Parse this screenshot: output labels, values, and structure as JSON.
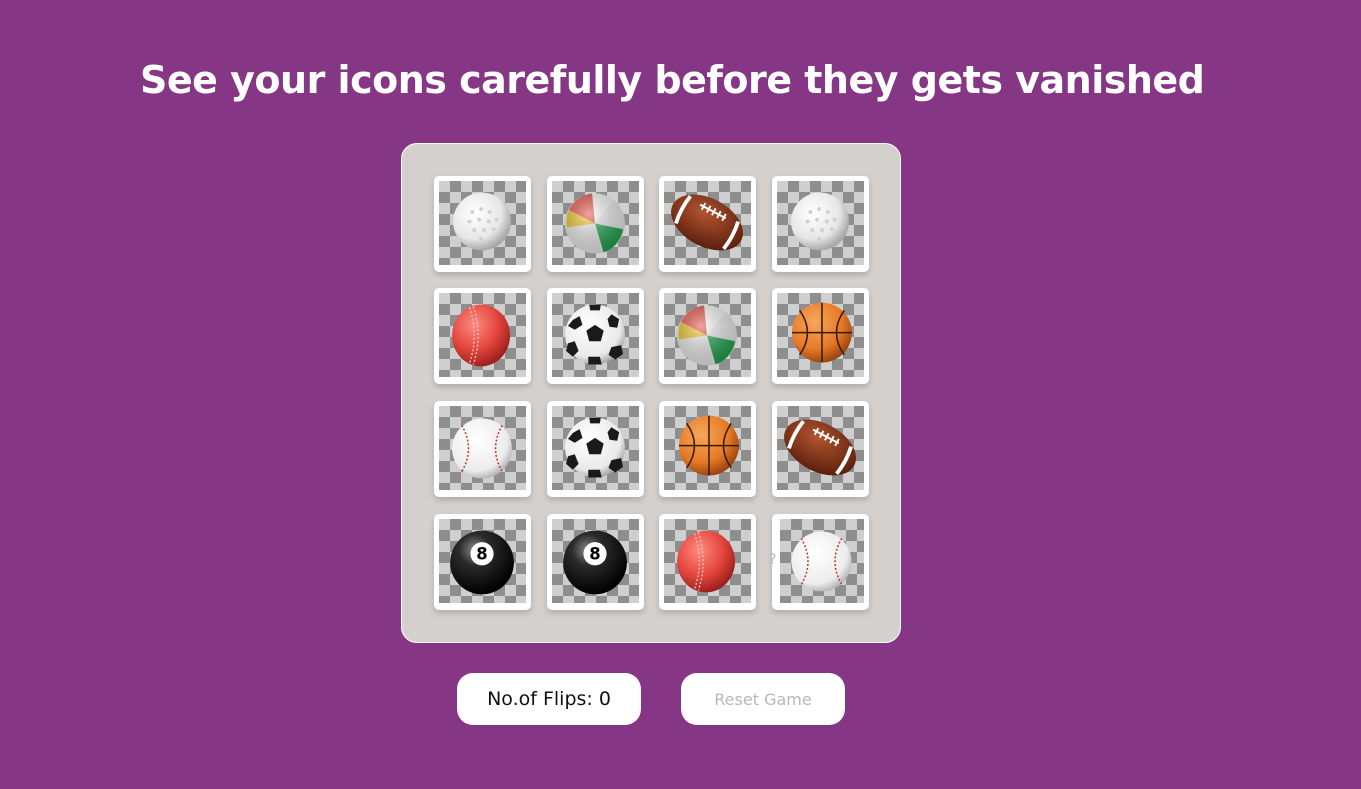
{
  "title": "See your icons carefully before they gets vanished",
  "board": {
    "columns": 4,
    "cards": [
      {
        "ball": "golf-ball"
      },
      {
        "ball": "beach-ball"
      },
      {
        "ball": "american-football"
      },
      {
        "ball": "golf-ball"
      },
      {
        "ball": "cricket-ball"
      },
      {
        "ball": "soccer-ball"
      },
      {
        "ball": "beach-ball"
      },
      {
        "ball": "basketball"
      },
      {
        "ball": "baseball"
      },
      {
        "ball": "soccer-ball"
      },
      {
        "ball": "basketball"
      },
      {
        "ball": "american-football"
      },
      {
        "ball": "eight-ball"
      },
      {
        "ball": "eight-ball"
      },
      {
        "ball": "cricket-ball"
      },
      {
        "ball": "baseball",
        "hidden_marker": "?"
      }
    ]
  },
  "controls": {
    "flips_label": "No.of Flips: 0",
    "reset_label": "Reset Game"
  },
  "colors": {
    "background": "#853684",
    "board": "#d4d0ce",
    "card": "#ffffff"
  }
}
